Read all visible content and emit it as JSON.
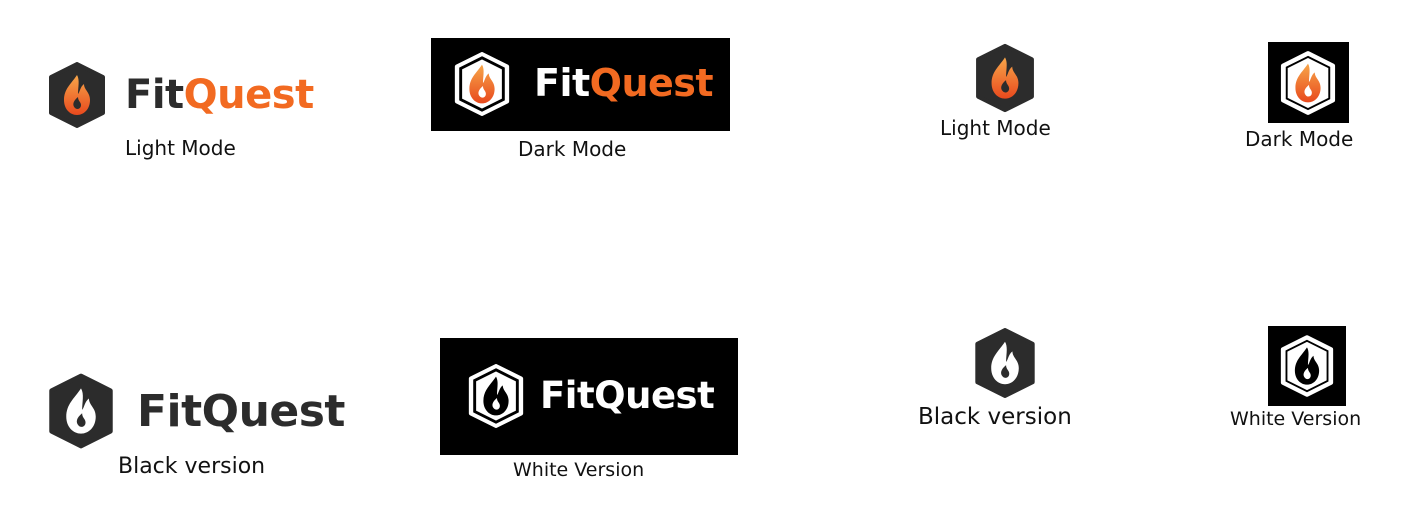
{
  "brand": {
    "fit": "Fit",
    "quest": "Quest"
  },
  "colors": {
    "orange": "#f26a21",
    "orange_light": "#f7a64a",
    "dark": "#2c2c2c",
    "black": "#000000",
    "white": "#ffffff"
  },
  "row1": {
    "light_full_label": "Light Mode",
    "dark_full_label": "Dark Mode",
    "light_icon_label": "Light Mode",
    "dark_icon_label": "Dark Mode"
  },
  "row2": {
    "black_full_label": "Black version",
    "white_full_label": "White Version",
    "black_icon_label": "Black version",
    "white_icon_label": "White Version"
  }
}
